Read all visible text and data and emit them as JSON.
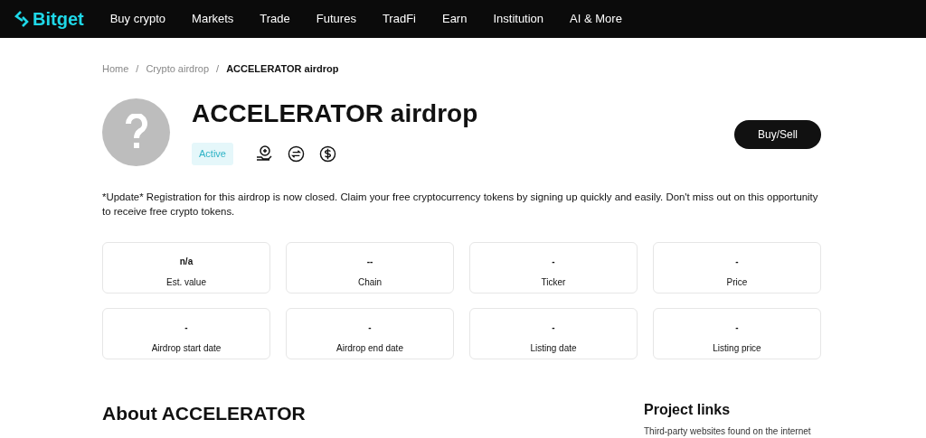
{
  "navbar": {
    "logo": "Bitget",
    "items": [
      "Buy crypto",
      "Markets",
      "Trade",
      "Futures",
      "TradFi",
      "Earn",
      "Institution",
      "AI & More"
    ]
  },
  "breadcrumb": {
    "items": [
      "Home",
      "Crypto airdrop",
      "ACCELERATOR airdrop"
    ],
    "separators": [
      "/",
      "/"
    ]
  },
  "header": {
    "title": "ACCELERATOR airdrop",
    "status": "Active",
    "action": "Buy/Sell"
  },
  "description": "*Update* Registration for this airdrop is now closed. Claim your free cryptocurrency tokens by signing up quickly and easily. Don't miss out on this opportunity to receive free crypto tokens.",
  "stats": [
    {
      "value": "n/a",
      "label": "Est. value"
    },
    {
      "value": "--",
      "label": "Chain"
    },
    {
      "value": "-",
      "label": "Ticker"
    },
    {
      "value": "-",
      "label": "Price"
    },
    {
      "value": "-",
      "label": "Airdrop start date"
    },
    {
      "value": "-",
      "label": "Airdrop end date"
    },
    {
      "value": "-",
      "label": "Listing date"
    },
    {
      "value": "-",
      "label": "Listing price"
    }
  ],
  "about": {
    "title": "About ACCELERATOR"
  },
  "project_links": {
    "title": "Project links",
    "note": "Third-party websites found on the internet"
  }
}
